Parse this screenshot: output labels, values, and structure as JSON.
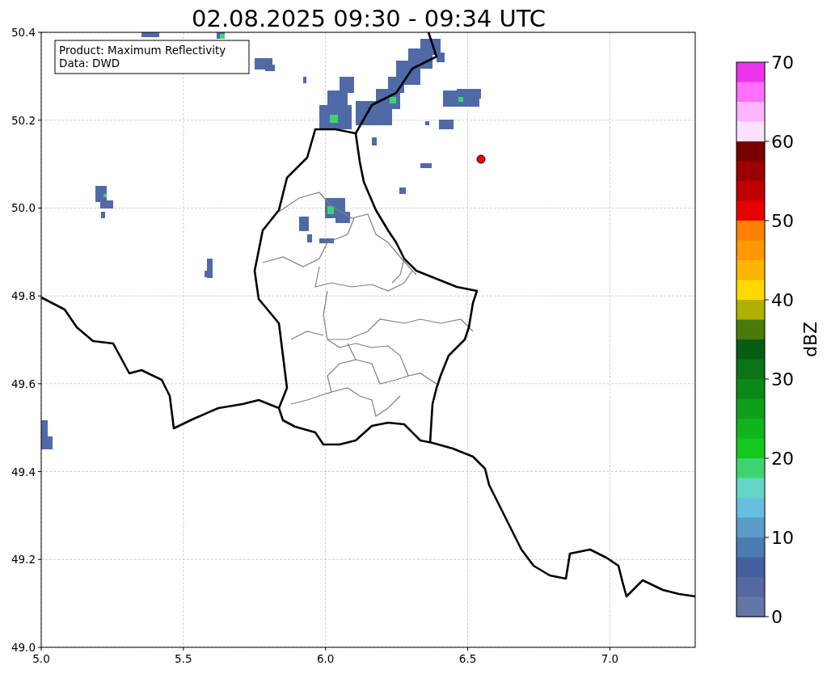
{
  "title": "02.08.2025 09:30 - 09:34 UTC",
  "map": {
    "info_box": [
      "Product: Maximum Reflectivity",
      "Data: DWD"
    ],
    "xticks": [
      "5.0",
      "5.5",
      "6.0",
      "6.5",
      "7.0"
    ],
    "yticks": [
      "50.4",
      "50.2",
      "50.0",
      "49.8",
      "49.6",
      "49.4",
      "49.2",
      "49.0"
    ]
  },
  "colorbar": {
    "label": "dBZ",
    "ticks": [
      "70",
      "60",
      "50",
      "40",
      "30",
      "20",
      "10",
      "0"
    ],
    "segments": [
      {
        "color": "#ee33ee"
      },
      {
        "color": "#ff70ff"
      },
      {
        "color": "#ffb4ff"
      },
      {
        "color": "#ffe0ff"
      },
      {
        "color": "#780000"
      },
      {
        "color": "#9c0000"
      },
      {
        "color": "#c00000"
      },
      {
        "color": "#e60000"
      },
      {
        "color": "#ff8000"
      },
      {
        "color": "#ff9800"
      },
      {
        "color": "#ffb400"
      },
      {
        "color": "#ffd800"
      },
      {
        "color": "#b0b000"
      },
      {
        "color": "#4a7a0a"
      },
      {
        "color": "#085c12"
      },
      {
        "color": "#0a7416"
      },
      {
        "color": "#0b8818"
      },
      {
        "color": "#0ea01a"
      },
      {
        "color": "#10b41c"
      },
      {
        "color": "#14c81e"
      },
      {
        "color": "#3cd470"
      },
      {
        "color": "#64d6c8"
      },
      {
        "color": "#66bee0"
      },
      {
        "color": "#5a9cc8"
      },
      {
        "color": "#4a7cb2"
      },
      {
        "color": "#4560a0"
      },
      {
        "color": "#56689f"
      },
      {
        "color": "#6576a8"
      }
    ]
  }
}
